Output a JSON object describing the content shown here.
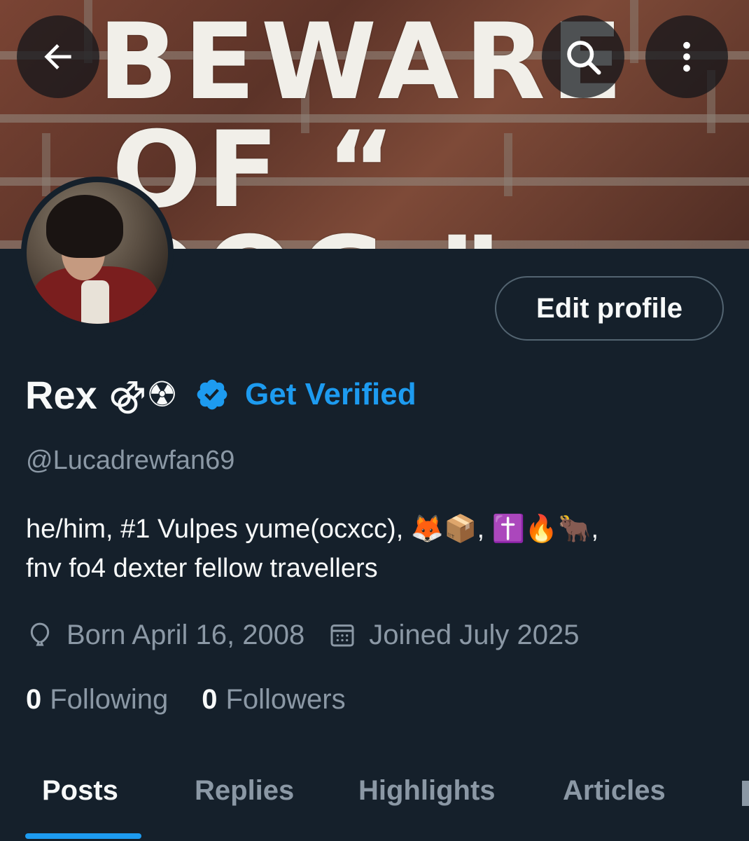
{
  "banner": {
    "line1": "BEWARE",
    "line2": "OF “ DOG ”"
  },
  "header": {
    "back_icon": "arrow-left-icon",
    "search_icon": "search-icon",
    "more_icon": "more-vertical-icon"
  },
  "profile": {
    "edit_label": "Edit profile",
    "name": "Rex",
    "name_symbols": "⚣☢",
    "verified_icon": "verified-badge-icon",
    "get_verified_label": "Get Verified",
    "handle": "@Lucadrewfan69",
    "bio_text_1": "he/him, #1 Vulpes yume(ocxcc), ",
    "bio_emoji_1": "🦊📦",
    "bio_sep_1": ", ",
    "bio_emoji_2": "✝️🔥🐂",
    "bio_sep_2": ",",
    "bio_text_2": "fnv fo4 dexter fellow travellers",
    "born": "Born April 16, 2008",
    "joined": "Joined July 2025",
    "following_count": "0",
    "following_label": "Following",
    "followers_count": "0",
    "followers_label": "Followers"
  },
  "tabs": [
    {
      "label": "Posts",
      "active": true
    },
    {
      "label": "Replies",
      "active": false
    },
    {
      "label": "Highlights",
      "active": false
    },
    {
      "label": "Articles",
      "active": false
    }
  ],
  "colors": {
    "background": "#15202b",
    "accent": "#1d9bf0",
    "secondary_text": "#8b98a5"
  }
}
